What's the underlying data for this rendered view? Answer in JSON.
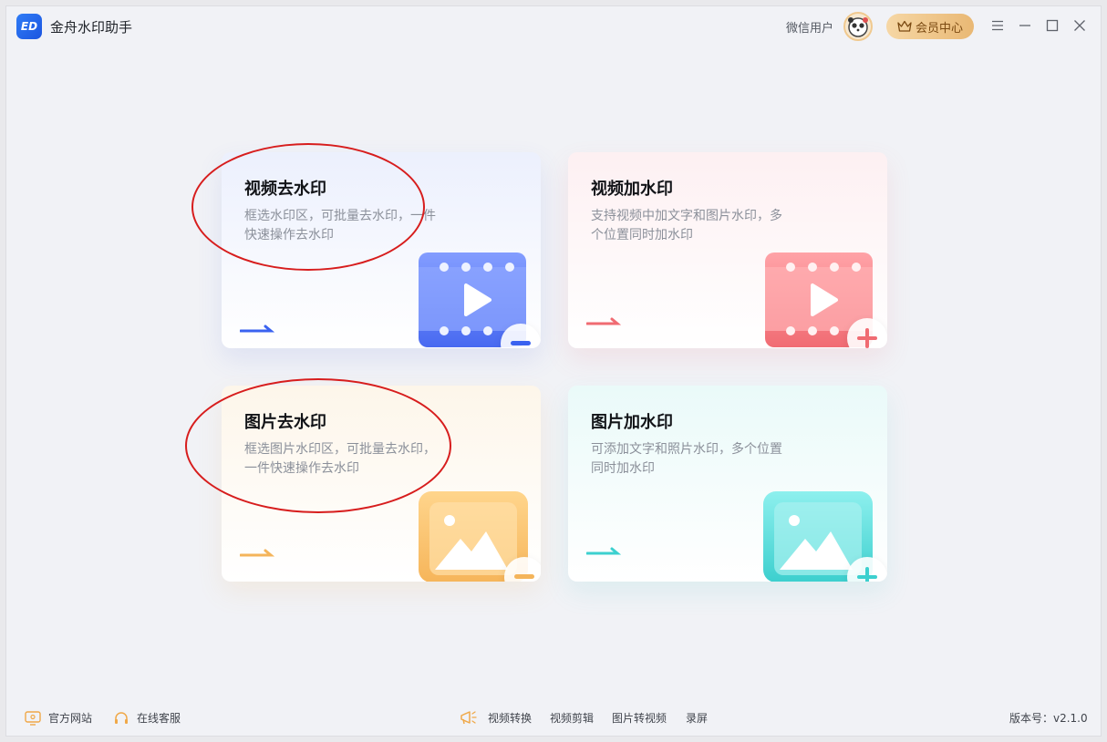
{
  "app": {
    "title": "金舟水印助手",
    "logo_text": "ED"
  },
  "header": {
    "user_name": "微信用户",
    "vip_label": "会员中心"
  },
  "cards": [
    {
      "title": "视频去水印",
      "desc": "框选水印区，可批量去水印，一件快速操作去水印",
      "accent": "#3a62f0",
      "icon": "video-remove-icon"
    },
    {
      "title": "视频加水印",
      "desc": "支持视频中加文字和图片水印，多个位置同时加水印",
      "accent": "#f06b72",
      "icon": "video-add-icon"
    },
    {
      "title": "图片去水印",
      "desc": "框选图片水印区，可批量去水印，一件快速操作去水印",
      "accent": "#f4b45a",
      "icon": "image-remove-icon"
    },
    {
      "title": "图片加水印",
      "desc": "可添加文字和照片水印，多个位置同时加水印",
      "accent": "#3cd0cf",
      "icon": "image-add-icon"
    }
  ],
  "footer": {
    "website": "官方网站",
    "support": "在线客服",
    "links": [
      "视频转换",
      "视频剪辑",
      "图片转视频",
      "录屏"
    ],
    "version": "版本号：v2.1.0"
  },
  "colors": {
    "annotation": "#d71d1d",
    "vip_gradient_start": "#f6d7a5",
    "vip_gradient_end": "#e9b874"
  }
}
